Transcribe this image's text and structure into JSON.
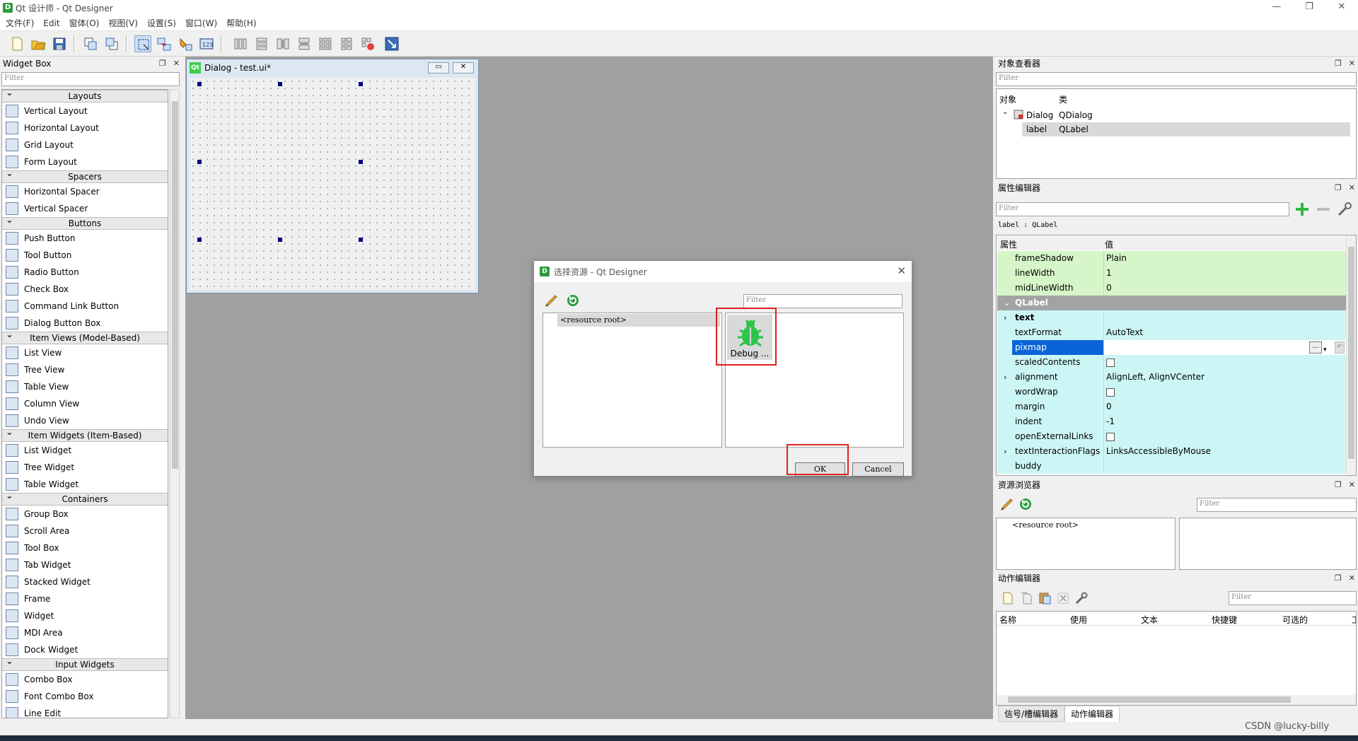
{
  "window": {
    "title": "Qt 设计师 - Qt Designer",
    "app_icon": "D",
    "controls": [
      "—",
      "❐",
      "✕"
    ]
  },
  "menubar": [
    "文件(F)",
    "Edit",
    "窗体(O)",
    "视图(V)",
    "设置(S)",
    "窗口(W)",
    "帮助(H)"
  ],
  "widget_box": {
    "title": "Widget Box",
    "filter_placeholder": "Filter",
    "categories": [
      {
        "label": "Layouts",
        "items": [
          "Vertical Layout",
          "Horizontal Layout",
          "Grid Layout",
          "Form Layout"
        ]
      },
      {
        "label": "Spacers",
        "items": [
          "Horizontal Spacer",
          "Vertical Spacer"
        ]
      },
      {
        "label": "Buttons",
        "items": [
          "Push Button",
          "Tool Button",
          "Radio Button",
          "Check Box",
          "Command Link Button",
          "Dialog Button Box"
        ]
      },
      {
        "label": "Item Views (Model-Based)",
        "items": [
          "List View",
          "Tree View",
          "Table View",
          "Column View",
          "Undo View"
        ]
      },
      {
        "label": "Item Widgets (Item-Based)",
        "items": [
          "List Widget",
          "Tree Widget",
          "Table Widget"
        ]
      },
      {
        "label": "Containers",
        "items": [
          "Group Box",
          "Scroll Area",
          "Tool Box",
          "Tab Widget",
          "Stacked Widget",
          "Frame",
          "Widget",
          "MDI Area",
          "Dock Widget"
        ]
      },
      {
        "label": "Input Widgets",
        "items": [
          "Combo Box",
          "Font Combo Box",
          "Line Edit"
        ]
      }
    ]
  },
  "form": {
    "title": "Dialog - test.ui*",
    "qt_logo": "Qt"
  },
  "resource_dialog": {
    "title": "选择资源 - Qt Designer",
    "filter_placeholder": "Filter",
    "tree_root": "<resource root>",
    "file_label": "Debug ...",
    "ok_label": "OK",
    "cancel_label": "Cancel"
  },
  "object_inspector": {
    "title": "对象查看器",
    "filter_placeholder": "Filter",
    "col_object": "对象",
    "col_class": "类",
    "rows": [
      {
        "object": "Dialog",
        "class": "QDialog"
      },
      {
        "object": "label",
        "class": "QLabel"
      }
    ]
  },
  "property_editor": {
    "title": "属性编辑器",
    "filter_placeholder": "Filter",
    "context": "label : QLabel",
    "col_property": "属性",
    "col_value": "值",
    "section_label": "QLabel",
    "rows_before": [
      {
        "name": "frameShadow",
        "value": "Plain"
      },
      {
        "name": "lineWidth",
        "value": "1"
      },
      {
        "name": "midLineWidth",
        "value": "0"
      }
    ],
    "rows_after": [
      {
        "name": "text",
        "value": "",
        "expandable": true,
        "bold": true
      },
      {
        "name": "textFormat",
        "value": "AutoText"
      },
      {
        "name": "pixmap",
        "value": "",
        "selected": true,
        "dots": "..."
      },
      {
        "name": "scaledContents",
        "value": "",
        "checkbox": true
      },
      {
        "name": "alignment",
        "value": "AlignLeft, AlignVCenter",
        "expandable": true
      },
      {
        "name": "wordWrap",
        "value": "",
        "checkbox": true
      },
      {
        "name": "margin",
        "value": "0"
      },
      {
        "name": "indent",
        "value": "-1"
      },
      {
        "name": "openExternalLinks",
        "value": "",
        "checkbox": true
      },
      {
        "name": "textInteractionFlags",
        "value": "LinksAccessibleByMouse",
        "expandable": true
      },
      {
        "name": "buddy",
        "value": ""
      }
    ]
  },
  "resource_browser": {
    "title": "资源浏览器",
    "filter_placeholder": "Filter",
    "tree_root": "<resource root>"
  },
  "action_editor": {
    "title": "动作编辑器",
    "filter_placeholder": "Filter",
    "columns": [
      "名称",
      "使用",
      "文本",
      "快捷键",
      "可选的",
      "工"
    ]
  },
  "bottom_tabs": [
    "信号/槽编辑器",
    "动作编辑器"
  ],
  "watermark": "CSDN @lucky-billy",
  "colors": {
    "accent_red": "#e02020",
    "selection_blue": "#0a64d8",
    "property_green": "#d6f5c8",
    "property_cyan": "#ccf6f6",
    "qt_green": "#41cd52"
  }
}
